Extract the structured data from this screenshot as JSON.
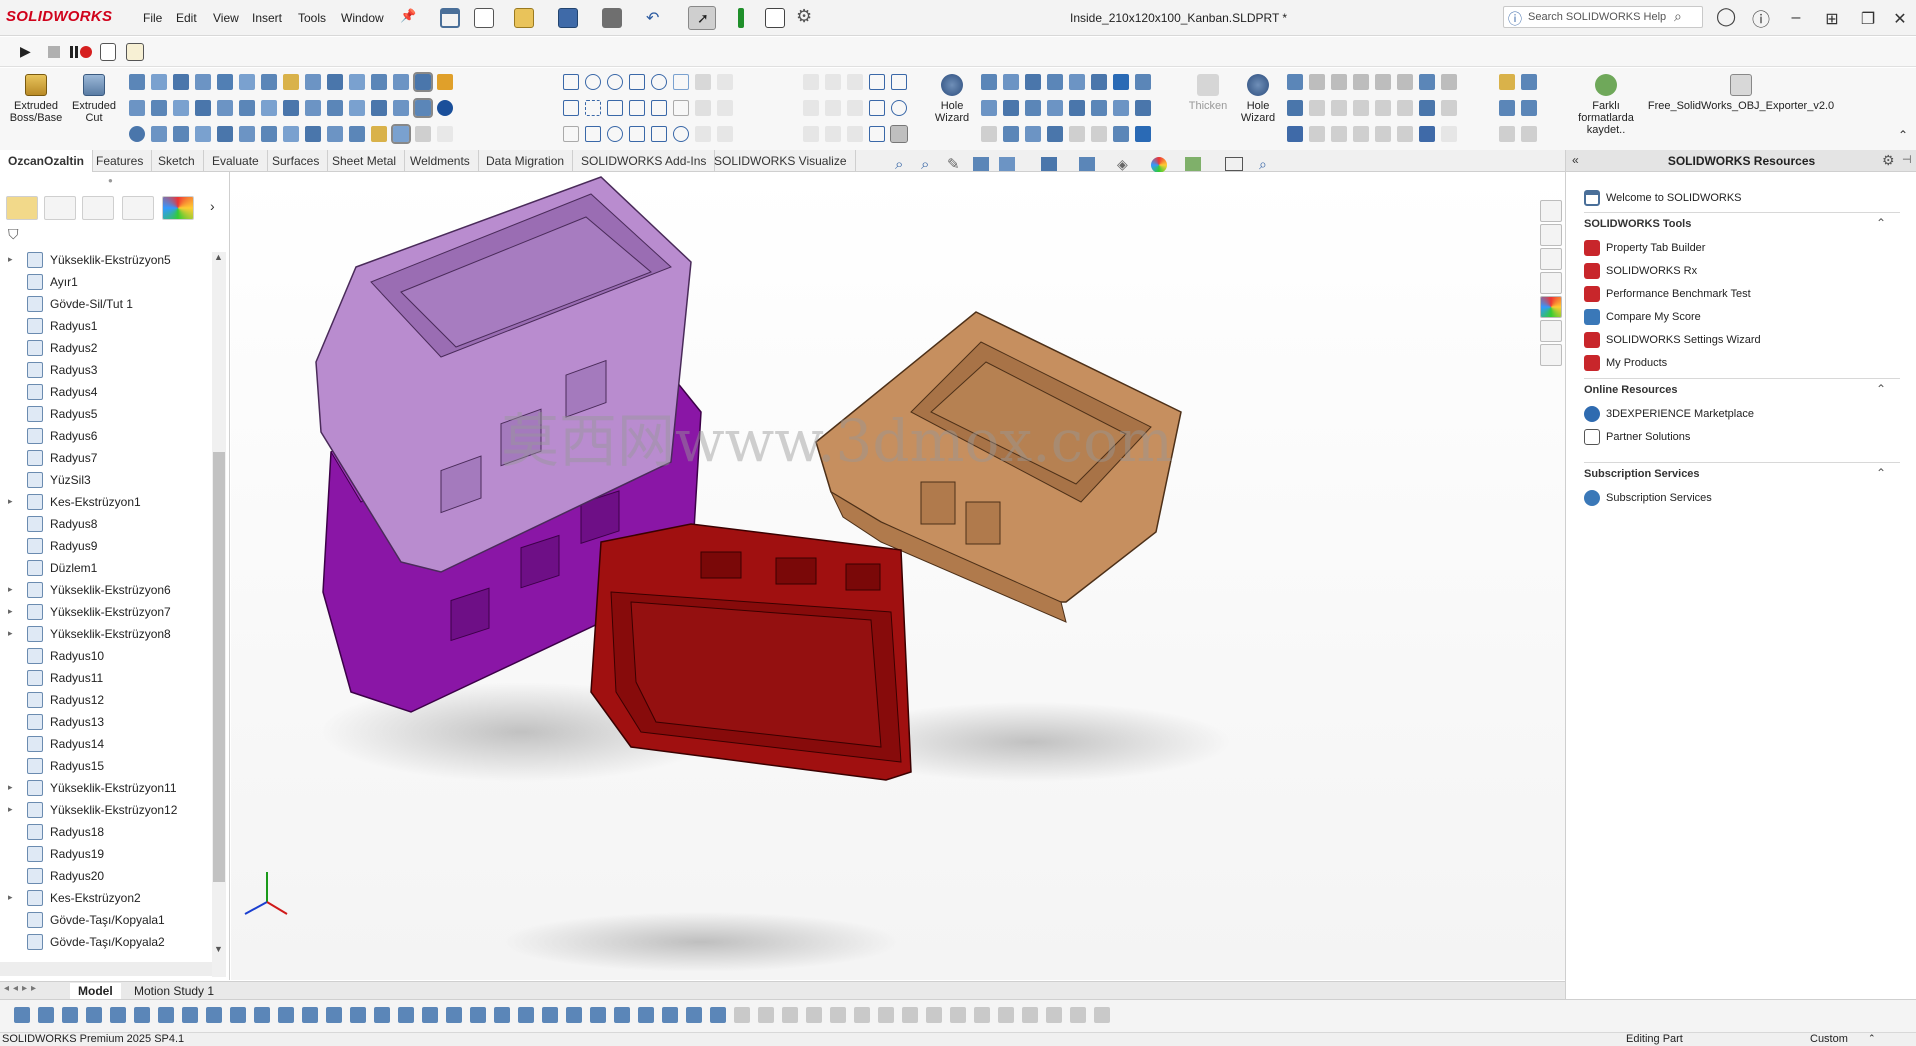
{
  "app": {
    "brand": "SOLIDWORKS",
    "document_title": "Inside_210x120x100_Kanban.SLDPRT *",
    "menu": [
      "File",
      "Edit",
      "View",
      "Insert",
      "Tools",
      "Window"
    ],
    "search_placeholder": "Search SOLIDWORKS Help"
  },
  "command_manager": {
    "extruded_boss": "Extruded Boss/Base",
    "extruded_cut": "Extruded Cut",
    "hole_wizard_1": "Hole Wizard",
    "thicken": "Thicken",
    "hole_wizard_2": "Hole Wizard",
    "save_as": "Farklı formatlarda kaydet..",
    "obj_exporter": "Free_SolidWorks_OBJ_Exporter_v2.0",
    "tabs": [
      "OzcanOzaltin",
      "Features",
      "Sketch",
      "Evaluate",
      "Surfaces",
      "Sheet Metal",
      "Weldments",
      "Data Migration",
      "SOLIDWORKS Add-Ins",
      "SOLIDWORKS Visualize"
    ]
  },
  "feature_tree": [
    {
      "label": "Yükseklik-Ekstrüzyon5",
      "expandable": true
    },
    {
      "label": "Ayır1",
      "expandable": false
    },
    {
      "label": "Gövde-Sil/Tut 1",
      "expandable": false
    },
    {
      "label": "Radyus1",
      "expandable": false
    },
    {
      "label": "Radyus2",
      "expandable": false
    },
    {
      "label": "Radyus3",
      "expandable": false
    },
    {
      "label": "Radyus4",
      "expandable": false
    },
    {
      "label": "Radyus5",
      "expandable": false
    },
    {
      "label": "Radyus6",
      "expandable": false
    },
    {
      "label": "Radyus7",
      "expandable": false
    },
    {
      "label": "YüzSil3",
      "expandable": false
    },
    {
      "label": "Kes-Ekstrüzyon1",
      "expandable": true
    },
    {
      "label": "Radyus8",
      "expandable": false
    },
    {
      "label": "Radyus9",
      "expandable": false
    },
    {
      "label": "Düzlem1",
      "expandable": false
    },
    {
      "label": "Yükseklik-Ekstrüzyon6",
      "expandable": true
    },
    {
      "label": "Yükseklik-Ekstrüzyon7",
      "expandable": true
    },
    {
      "label": "Yükseklik-Ekstrüzyon8",
      "expandable": true
    },
    {
      "label": "Radyus10",
      "expandable": false
    },
    {
      "label": "Radyus11",
      "expandable": false
    },
    {
      "label": "Radyus12",
      "expandable": false
    },
    {
      "label": "Radyus13",
      "expandable": false
    },
    {
      "label": "Radyus14",
      "expandable": false
    },
    {
      "label": "Radyus15",
      "expandable": false
    },
    {
      "label": "Yükseklik-Ekstrüzyon11",
      "expandable": true
    },
    {
      "label": "Yükseklik-Ekstrüzyon12",
      "expandable": true
    },
    {
      "label": "Radyus18",
      "expandable": false
    },
    {
      "label": "Radyus19",
      "expandable": false
    },
    {
      "label": "Radyus20",
      "expandable": false
    },
    {
      "label": "Kes-Ekstrüzyon2",
      "expandable": true
    },
    {
      "label": "Gövde-Taşı/Kopyala1",
      "expandable": false
    },
    {
      "label": "Gövde-Taşı/Kopyala2",
      "expandable": false
    }
  ],
  "bottom_tabs": [
    "Model",
    "Motion Study 1"
  ],
  "watermark": "莫西网www.3dmox.com",
  "resources": {
    "title": "SOLIDWORKS Resources",
    "welcome": "Welcome to SOLIDWORKS",
    "sections": [
      {
        "title": "SOLIDWORKS Tools",
        "items": [
          "Property Tab Builder",
          "SOLIDWORKS Rx",
          "Performance Benchmark Test",
          "Compare My Score",
          "SOLIDWORKS Settings Wizard",
          "My Products"
        ]
      },
      {
        "title": "Online Resources",
        "items": [
          "3DEXPERIENCE Marketplace",
          "Partner Solutions"
        ]
      },
      {
        "title": "Subscription Services",
        "items": [
          "Subscription Services"
        ]
      }
    ]
  },
  "status": {
    "product": "SOLIDWORKS Premium 2025 SP4.1",
    "mode": "Editing Part",
    "units": "Custom"
  },
  "colors": {
    "bin_violet": "#b98ccf",
    "bin_purple": "#8a16a6",
    "bin_tan": "#c68f5f",
    "bin_red": "#a01010",
    "brand_red": "#d0021b"
  }
}
